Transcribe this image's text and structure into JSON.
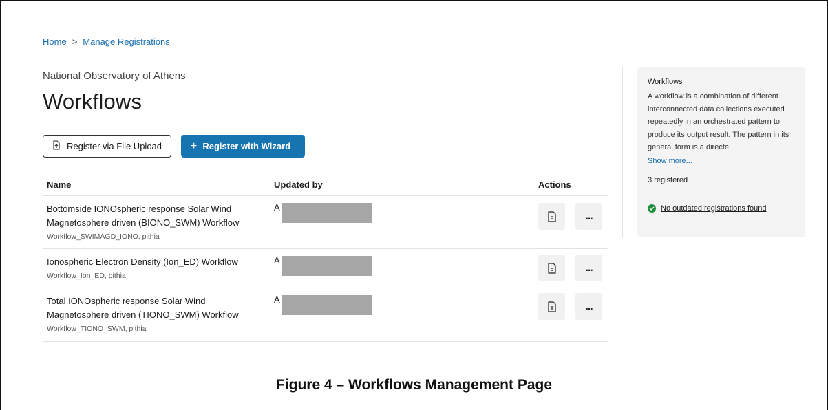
{
  "breadcrumb": {
    "home": "Home",
    "separator": ">",
    "current": "Manage Registrations"
  },
  "header": {
    "organization": "National Observatory of Athens",
    "title": "Workflows"
  },
  "buttons": {
    "upload_label": "Register via File Upload",
    "wizard_plus": "+",
    "wizard_label": "Register with Wizard"
  },
  "table": {
    "headers": {
      "name": "Name",
      "updated_by": "Updated by",
      "actions": "Actions"
    },
    "rows": [
      {
        "name": "Bottomside IONOspheric response Solar Wind Magnetosphere driven (BIONO_SWM) Workflow",
        "subtitle": "Workflow_SWIMAGD_IONO, pithia",
        "updated_initial": "A"
      },
      {
        "name": "Ionospheric Electron Density (Ion_ED) Workflow",
        "subtitle": "Workflow_Ion_ED, pithia",
        "updated_initial": "A"
      },
      {
        "name": "Total IONOspheric response Solar Wind Magnetosphere driven (TIONO_SWM) Workflow",
        "subtitle": "Workflow_TIONO_SWM, pithia",
        "updated_initial": "A"
      }
    ],
    "more_label": "..."
  },
  "panel": {
    "title": "Workflows",
    "description": "A workflow is a combination of different interconnected data collections executed repeatedly in an orchestrated pattern to produce its output result. The pattern in its general form is a directe...",
    "show_more": "Show more...",
    "count": "3 registered",
    "status": "No outdated registrations found"
  },
  "caption": "Figure 4 – Workflows Management Page",
  "colors": {
    "primary": "#1674b1",
    "link": "#1a6fb0",
    "success": "#1e8e3e",
    "redaction": "#a6a6a6"
  }
}
